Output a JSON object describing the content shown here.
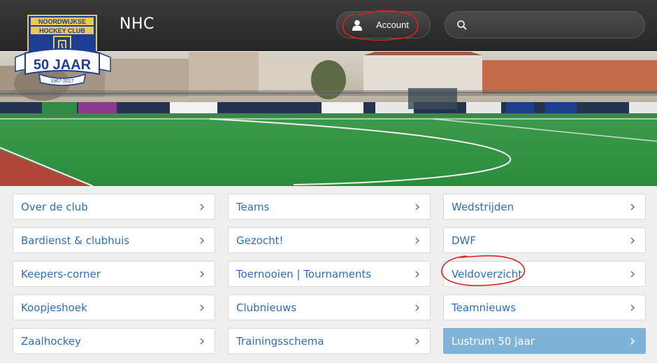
{
  "header": {
    "logo_text": {
      "line1": "NOORDWIJKSE",
      "line2": "HOCKEY CLUB",
      "anniversary": "50 JAAR",
      "years": "1967-2017"
    },
    "site_title": "NHC",
    "account_label": "Account",
    "search_placeholder": ""
  },
  "menu": {
    "columns": [
      [
        {
          "label": "Over de club"
        },
        {
          "label": "Bardienst & clubhuis"
        },
        {
          "label": "Keepers-corner"
        },
        {
          "label": "Koopjeshoek"
        },
        {
          "label": "Zaalhockey"
        }
      ],
      [
        {
          "label": "Teams"
        },
        {
          "label": "Gezocht!"
        },
        {
          "label": "Toernooien | Tournaments"
        },
        {
          "label": "Clubnieuws"
        },
        {
          "label": "Trainingsschema"
        }
      ],
      [
        {
          "label": "Wedstrijden"
        },
        {
          "label": "DWF"
        },
        {
          "label": "Veldoverzicht"
        },
        {
          "label": "Teamnieuws"
        },
        {
          "label": "Lustrum 50 jaar"
        }
      ]
    ]
  },
  "colors": {
    "link": "#2a6ebd",
    "highlight_bg": "#7fb4d8",
    "topbar": "#2e2e2e",
    "annotation": "#e0201c"
  }
}
